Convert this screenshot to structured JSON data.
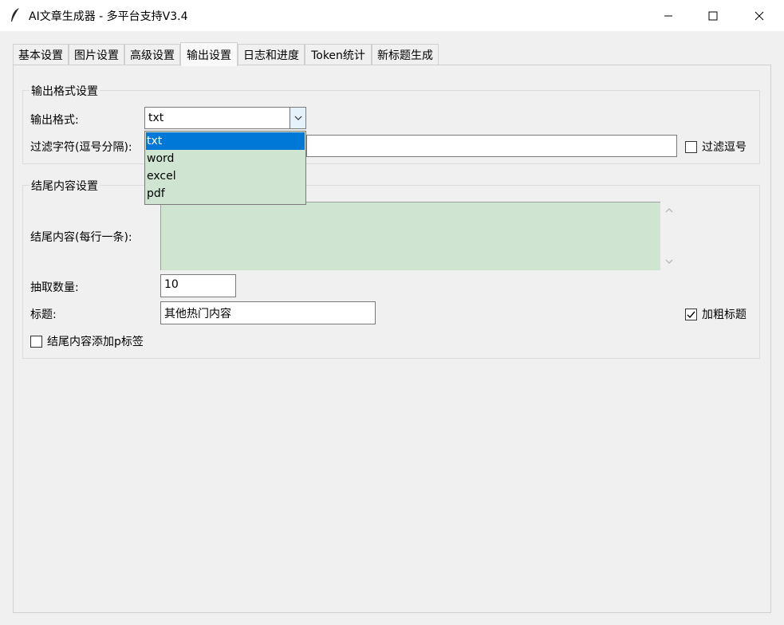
{
  "window": {
    "title": "AI文章生成器 - 多平台支持V3.4"
  },
  "tabs": [
    {
      "label": "基本设置"
    },
    {
      "label": "图片设置"
    },
    {
      "label": "高级设置"
    },
    {
      "label": "输出设置"
    },
    {
      "label": "日志和进度"
    },
    {
      "label": "Token统计"
    },
    {
      "label": "新标题生成"
    }
  ],
  "output_format_group": {
    "title": "输出格式设置",
    "format_label": "输出格式:",
    "format_value": "txt",
    "format_options": [
      "txt",
      "word",
      "excel",
      "pdf"
    ],
    "filter_label": "过滤字符(逗号分隔):",
    "filter_value": "",
    "filter_comma_label": "过滤逗号"
  },
  "ending_group": {
    "title": "结尾内容设置",
    "content_label": "结尾内容(每行一条):",
    "content_value": "",
    "count_label": "抽取数量:",
    "count_value": "10",
    "heading_label": "标题:",
    "heading_value": "其他热门内容",
    "bold_label": "加粗标题",
    "bold_checked": true,
    "p_tag_label": "结尾内容添加p标签",
    "p_tag_checked": false
  },
  "colors": {
    "selection": "#0078d7",
    "textarea_bg": "#cfe5d2",
    "panel_bg": "#f0f0f0"
  }
}
